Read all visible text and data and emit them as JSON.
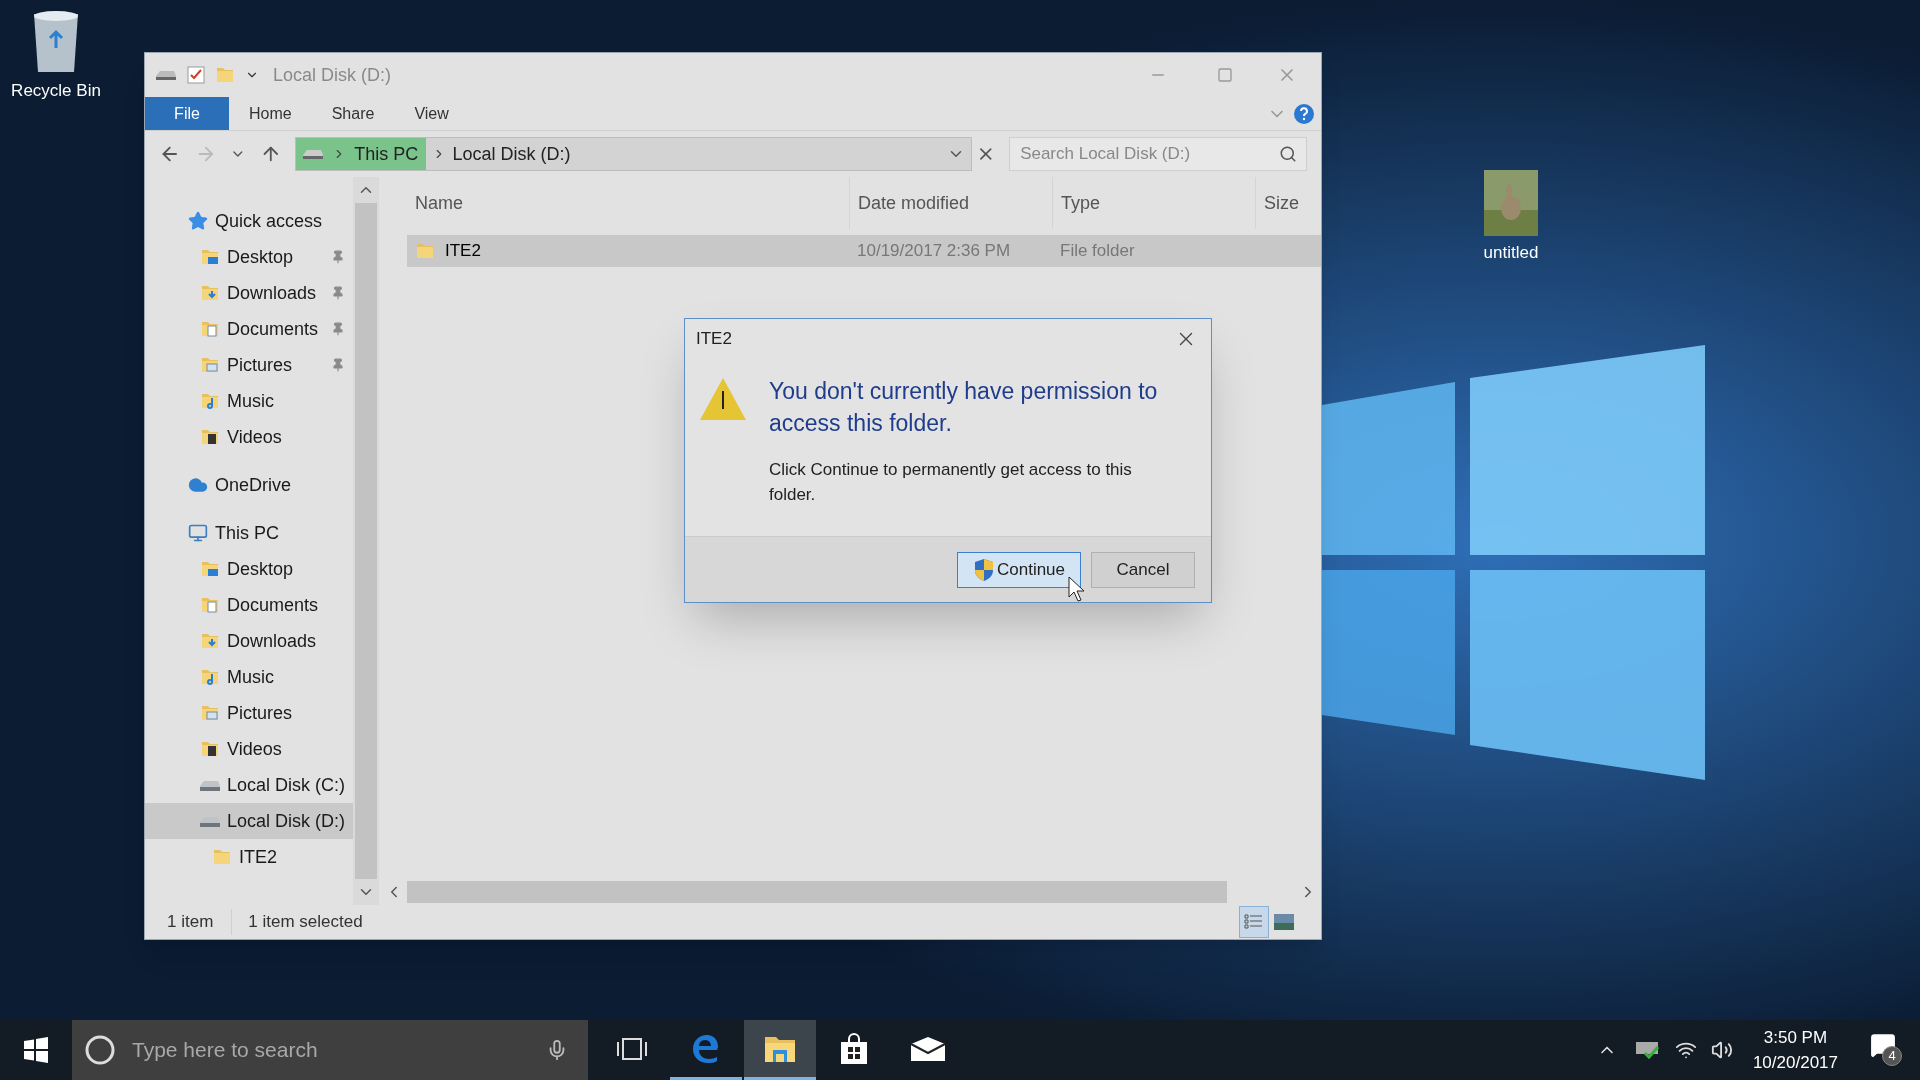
{
  "desktop_icons": [
    {
      "label": "Recycle Bin",
      "kind": "recycle"
    },
    {
      "label": "untitled",
      "kind": "image"
    }
  ],
  "explorer": {
    "title": "Local Disk (D:)",
    "ribbon_tabs": [
      {
        "label": "File",
        "selected": true
      },
      {
        "label": "Home",
        "selected": false
      },
      {
        "label": "Share",
        "selected": false
      },
      {
        "label": "View",
        "selected": false
      }
    ],
    "address": [
      "This PC",
      "Local Disk (D:)"
    ],
    "search": {
      "placeholder": "Search Local Disk (D:)"
    },
    "nav": [
      {
        "label": "Quick access",
        "kind": "star",
        "selected": false,
        "pinned": false,
        "children": [
          {
            "label": "Desktop",
            "kind": "desktop",
            "selected": false,
            "pinned": true
          },
          {
            "label": "Downloads",
            "kind": "downloads",
            "selected": false,
            "pinned": true
          },
          {
            "label": "Documents",
            "kind": "documents",
            "selected": false,
            "pinned": true
          },
          {
            "label": "Pictures",
            "kind": "pictures",
            "selected": false,
            "pinned": true
          },
          {
            "label": "Music",
            "kind": "music",
            "selected": false,
            "pinned": false
          },
          {
            "label": "Videos",
            "kind": "videos",
            "selected": false,
            "pinned": false
          }
        ]
      },
      {
        "label": "OneDrive",
        "kind": "cloud",
        "selected": false,
        "pinned": false
      },
      {
        "label": "This PC",
        "kind": "pc",
        "selected": false,
        "pinned": false,
        "children": [
          {
            "label": "Desktop",
            "kind": "desktop",
            "selected": false,
            "pinned": false
          },
          {
            "label": "Documents",
            "kind": "documents",
            "selected": false,
            "pinned": false
          },
          {
            "label": "Downloads",
            "kind": "downloads",
            "selected": false,
            "pinned": false
          },
          {
            "label": "Music",
            "kind": "music",
            "selected": false,
            "pinned": false
          },
          {
            "label": "Pictures",
            "kind": "pictures",
            "selected": false,
            "pinned": false
          },
          {
            "label": "Videos",
            "kind": "videos",
            "selected": false,
            "pinned": false
          },
          {
            "label": "Local Disk (C:)",
            "kind": "disk",
            "selected": false,
            "pinned": false
          },
          {
            "label": "Local Disk (D:)",
            "kind": "disk",
            "selected": true,
            "pinned": false,
            "children": [
              {
                "label": "ITE2",
                "kind": "folder",
                "selected": false,
                "pinned": false
              }
            ]
          }
        ]
      }
    ],
    "columns": [
      "Name",
      "Date modified",
      "Type",
      "Size"
    ],
    "rows": [
      {
        "name": "ITE2",
        "date": "10/19/2017 2:36 PM",
        "type": "File folder",
        "selected": true
      }
    ],
    "status_bar": {
      "count": "1 item",
      "selection": "1 item selected"
    },
    "view_buttons": [
      {
        "kind": "details",
        "selected": true
      },
      {
        "kind": "tiles",
        "selected": false
      }
    ]
  },
  "dialog": {
    "title": "ITE2",
    "heading": "You don't currently have permission to access this folder.",
    "message": "Click Continue to permanently get access to this folder.",
    "buttons": [
      {
        "label": "Continue",
        "kind": "shield",
        "selected": true
      },
      {
        "label": "Cancel",
        "kind": "plain",
        "selected": false
      }
    ]
  },
  "taskbar": {
    "search_placeholder": "Type here to search",
    "apps": [
      {
        "kind": "taskview",
        "running": false,
        "selected": false
      },
      {
        "kind": "edge",
        "running": true,
        "selected": false
      },
      {
        "kind": "explorer",
        "running": true,
        "selected": true
      },
      {
        "kind": "store",
        "running": false,
        "selected": false
      },
      {
        "kind": "mail",
        "running": false,
        "selected": false
      }
    ],
    "time": "3:50 PM",
    "date": "10/20/2017",
    "notifications": "4"
  }
}
